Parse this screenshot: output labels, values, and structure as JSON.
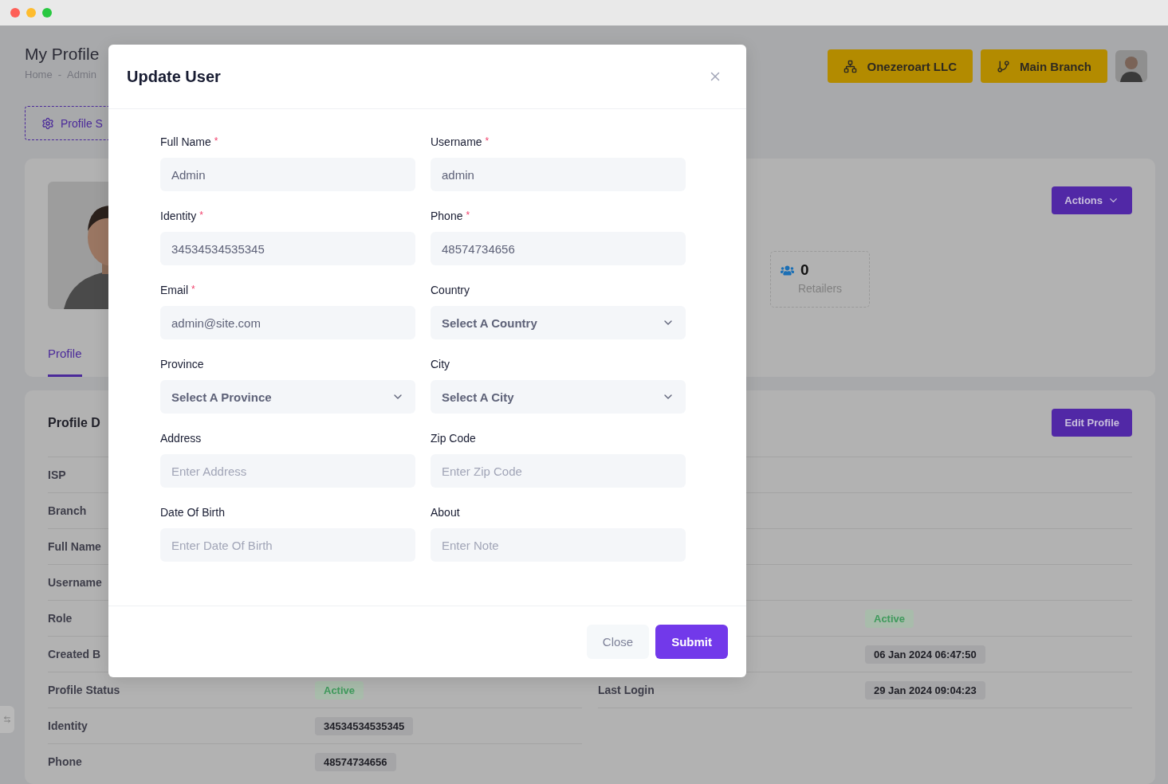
{
  "page": {
    "title": "My Profile",
    "breadcrumb": [
      "Home",
      "Admin"
    ],
    "breadcrumb_separator": "-"
  },
  "header_buttons": [
    {
      "label": "Onezeroart LLC",
      "kind": "company"
    },
    {
      "label": "Main Branch",
      "kind": "branch"
    }
  ],
  "settings_button": {
    "label": "Profile S"
  },
  "profile_card": {
    "actions_button": "Actions",
    "stats": [
      {
        "value": "0",
        "label": "Retailers"
      }
    ],
    "tabs": [
      {
        "label": "Profile",
        "selected": true
      }
    ]
  },
  "details": {
    "title": "Profile D",
    "edit_button": "Edit Profile",
    "left_rows": [
      {
        "label": "ISP"
      },
      {
        "label": "Branch"
      },
      {
        "label": "Full Name"
      },
      {
        "label": "Username"
      },
      {
        "label": "Role"
      },
      {
        "label": "Created B"
      },
      {
        "label": "Profile Status",
        "value": "Active",
        "kind": "status"
      },
      {
        "label": "Identity",
        "value": "34534534535345",
        "kind": "text"
      },
      {
        "label": "Phone",
        "value": "48574734656",
        "kind": "text"
      }
    ],
    "right_rows": [
      {
        "value": "Active",
        "kind": "status"
      },
      {
        "value": "06 Jan 2024 06:47:50",
        "kind": "text"
      },
      {
        "label": "Last Login",
        "value": "29 Jan 2024 09:04:23",
        "kind": "text"
      }
    ]
  },
  "modal": {
    "title": "Update User",
    "fields": [
      {
        "label": "Full Name",
        "required_mark": "*",
        "kind": "input",
        "value": "Admin"
      },
      {
        "label": "Username",
        "required_mark": "*",
        "kind": "input",
        "value": "admin"
      },
      {
        "label": "Identity",
        "required_mark": "*",
        "kind": "input",
        "value": "34534534535345"
      },
      {
        "label": "Phone",
        "required_mark": "*",
        "kind": "input",
        "value": "48574734656"
      },
      {
        "label": "Email",
        "required_mark": "*",
        "kind": "input",
        "value": "admin@site.com"
      },
      {
        "label": "Country",
        "kind": "select",
        "value": "Select A Country"
      },
      {
        "label": "Province",
        "kind": "select",
        "value": "Select A Province"
      },
      {
        "label": "City",
        "kind": "select",
        "value": "Select A City"
      },
      {
        "label": "Address",
        "kind": "input",
        "placeholder": "Enter Address"
      },
      {
        "label": "Zip Code",
        "kind": "input",
        "placeholder": "Enter Zip Code"
      },
      {
        "label": "Date Of Birth",
        "kind": "input",
        "placeholder": "Enter Date Of Birth"
      },
      {
        "label": "About",
        "kind": "input",
        "placeholder": "Enter Note"
      }
    ],
    "buttons": [
      {
        "label": "Close",
        "kind": "secondary"
      },
      {
        "label": "Submit",
        "kind": "primary"
      }
    ]
  }
}
